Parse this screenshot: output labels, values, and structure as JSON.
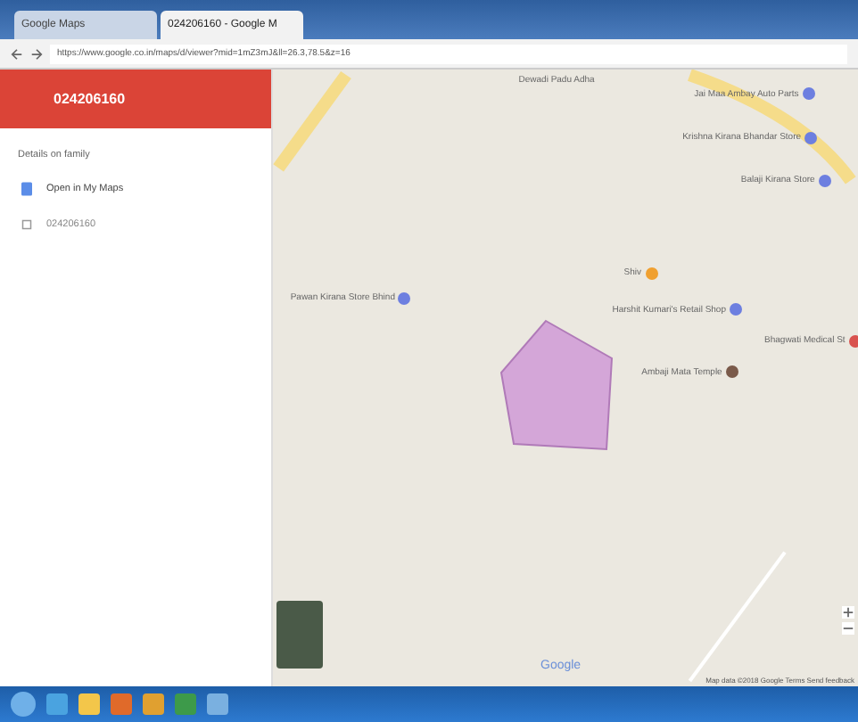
{
  "browser": {
    "tabs": [
      {
        "title": "Google Maps",
        "selected": false
      },
      {
        "title": "024206160 - Google M",
        "selected": true
      }
    ],
    "url": "https://www.google.co.in/maps/d/viewer?mid=1mZ3mJ&ll=26.3,78.5&z=16"
  },
  "sidebar": {
    "title": "024206160",
    "section": "Details on family",
    "items": [
      {
        "label": "Open in My Maps",
        "kind": "link"
      },
      {
        "label": "024206160",
        "kind": "layer"
      }
    ]
  },
  "map": {
    "labels": [
      {
        "text": "Dewadi Padu Adha"
      },
      {
        "text": "Jai Maa Ambay Auto Parts",
        "color": "#6d7fe0"
      },
      {
        "text": "Krishna Kirana Bhandar Store",
        "color": "#6d7fe0"
      },
      {
        "text": "Balaji Kirana Store",
        "color": "#6d7fe0"
      },
      {
        "text": "Pawan Kirana Store Bhind",
        "color": "#6d7fe0"
      },
      {
        "text": "Shiv",
        "color": "#f0a030"
      },
      {
        "text": "Harshit Kumari's Retail Shop",
        "color": "#6d7fe0"
      },
      {
        "text": "Bhagwati Medical St",
        "color": "#d9534f"
      },
      {
        "text": "Ambaji Mata Temple",
        "color": "#7a5a4a"
      }
    ],
    "logo": "Google",
    "attribution": "Map data ©2018 Google   Terms   Send feedback"
  }
}
